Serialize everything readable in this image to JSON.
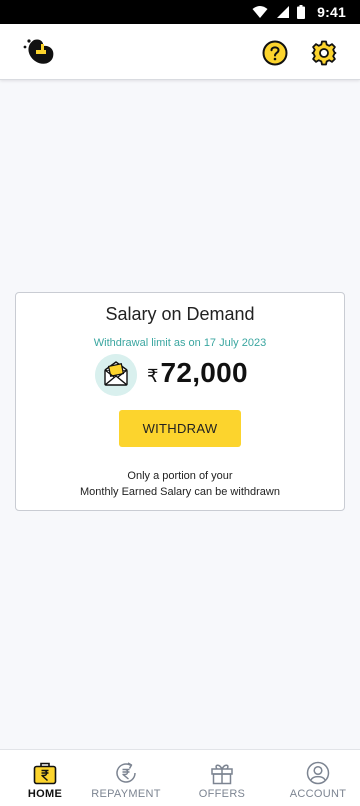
{
  "status_bar": {
    "time": "9:41"
  },
  "header": {
    "logo_icon": "app-logo-icon",
    "help_icon": "help-icon",
    "settings_icon": "settings-icon"
  },
  "card": {
    "title": "Salary on Demand",
    "limit_text": "Withdrawal limit as on 17 July 2023",
    "currency_symbol": "₹",
    "amount": "72,000",
    "withdraw_label": "WITHDRAW",
    "note_line1": "Only a portion of your",
    "note_line2": "Monthly Earned Salary can be withdrawn"
  },
  "bottom_nav": {
    "items": [
      {
        "label": "HOME",
        "icon": "wallet-icon",
        "active": true
      },
      {
        "label": "REPAYMENT",
        "icon": "repayment-icon",
        "active": false
      },
      {
        "label": "OFFERS",
        "icon": "gift-icon",
        "active": false
      },
      {
        "label": "ACCOUNT",
        "icon": "account-icon",
        "active": false
      }
    ]
  },
  "colors": {
    "accent": "#fcd42d",
    "teal": "#3aa6a0",
    "background": "#f7f8fb"
  }
}
